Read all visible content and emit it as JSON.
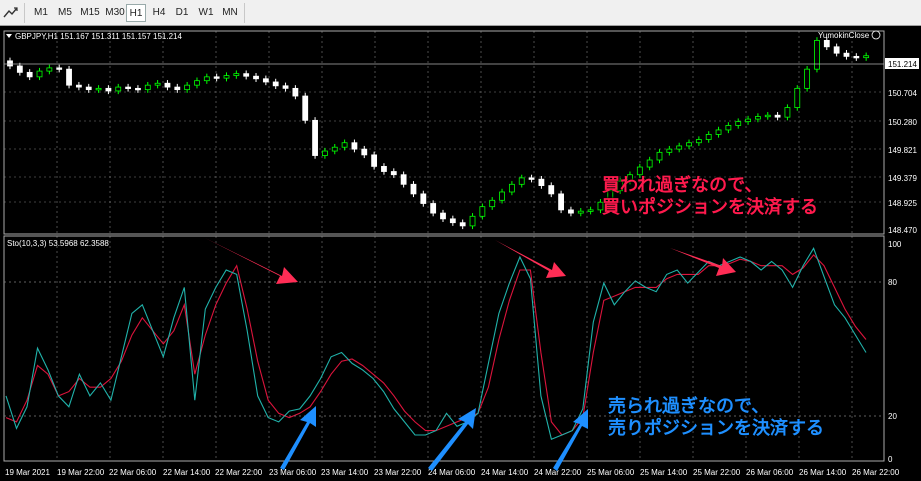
{
  "toolbar": {
    "timeframes": [
      "M1",
      "M5",
      "M15",
      "M30",
      "H1",
      "H4",
      "D1",
      "W1",
      "MN"
    ],
    "active": "H1"
  },
  "main_chart": {
    "header": "GBPJPY,H1  151.167 151.311 151.157 151.214",
    "indicator_label": "YumokinClose",
    "current_price": "151.214",
    "price_labels": [
      "150.704",
      "150.280",
      "149.821",
      "149.379",
      "148.925",
      "148.470"
    ]
  },
  "indicator": {
    "header": "Sto(10,3,3) 53.5968 62.3588",
    "levels": [
      "100",
      "80",
      "20",
      "0"
    ]
  },
  "time_axis": [
    "19 Mar 2021",
    "19 Mar 22:00",
    "22 Mar 06:00",
    "22 Mar 14:00",
    "22 Mar 22:00",
    "23 Mar 06:00",
    "23 Mar 14:00",
    "23 Mar 22:00",
    "24 Mar 06:00",
    "24 Mar 14:00",
    "24 Mar 22:00",
    "25 Mar 06:00",
    "25 Mar 14:00",
    "25 Mar 22:00",
    "26 Mar 06:00",
    "26 Mar 14:00",
    "26 Mar 22:00"
  ],
  "annotations": {
    "overbought": [
      "買われ過ぎなので、",
      "買いポジションを決済する"
    ],
    "oversold": [
      "売られ過ぎなので、",
      "売りポジションを決済する"
    ]
  },
  "colors": {
    "bull_candle": "#00ff00",
    "bear_candle": "#ffffff",
    "stoch_main": "#20b2aa",
    "stoch_signal": "#dc143c",
    "arrow_red": "#ff2d55",
    "arrow_blue": "#1e8fff",
    "grid": "#808080"
  },
  "chart_data": {
    "type": "candlestick",
    "closes": [
      151.05,
      150.95,
      150.88,
      150.97,
      151.02,
      151.0,
      150.75,
      150.72,
      150.68,
      150.7,
      150.66,
      150.72,
      150.7,
      150.68,
      150.75,
      150.78,
      150.72,
      150.68,
      150.75,
      150.82,
      150.88,
      150.86,
      150.9,
      150.93,
      150.89,
      150.85,
      150.8,
      150.74,
      150.7,
      150.58,
      150.2,
      149.65,
      149.72,
      149.78,
      149.85,
      149.75,
      149.66,
      149.48,
      149.4,
      149.35,
      149.2,
      149.05,
      148.9,
      148.75,
      148.66,
      148.6,
      148.55,
      148.7,
      148.85,
      148.95,
      149.08,
      149.2,
      149.3,
      149.28,
      149.18,
      149.05,
      148.8,
      148.75,
      148.78,
      148.8,
      148.92,
      149.1,
      149.25,
      149.35,
      149.47,
      149.58,
      149.7,
      149.75,
      149.8,
      149.85,
      149.9,
      149.98,
      150.05,
      150.12,
      150.18,
      150.22,
      150.26,
      150.28,
      150.25,
      150.4,
      150.7,
      151.0,
      151.45,
      151.35,
      151.25,
      151.2,
      151.18,
      151.21
    ],
    "stochastic_main": [
      30,
      15,
      25,
      52,
      42,
      30,
      25,
      40,
      30,
      36,
      28,
      48,
      68,
      72,
      60,
      48,
      66,
      80,
      28,
      70,
      80,
      88,
      86,
      60,
      30,
      20,
      18,
      23,
      24,
      30,
      38,
      48,
      50,
      45,
      42,
      38,
      32,
      24,
      18,
      12,
      12,
      14,
      22,
      16,
      18,
      22,
      45,
      68,
      82,
      94,
      84,
      30,
      10,
      12,
      14,
      24,
      64,
      82,
      72,
      78,
      83,
      80,
      78,
      86,
      88,
      82,
      87,
      92,
      90,
      92,
      94,
      92,
      88,
      92,
      88,
      80,
      90,
      98,
      85,
      72,
      66,
      58,
      50
    ],
    "stochastic_signal": [
      20,
      18,
      28,
      44,
      40,
      30,
      32,
      38,
      34,
      34,
      38,
      46,
      58,
      66,
      60,
      54,
      60,
      72,
      40,
      58,
      72,
      82,
      90,
      70,
      46,
      28,
      22,
      20,
      22,
      25,
      32,
      40,
      46,
      47,
      44,
      40,
      36,
      30,
      23,
      18,
      14,
      14,
      16,
      18,
      20,
      22,
      34,
      56,
      74,
      88,
      88,
      50,
      18,
      12,
      14,
      20,
      50,
      74,
      76,
      78,
      80,
      80,
      80,
      84,
      86,
      86,
      86,
      90,
      90,
      91,
      93,
      92,
      90,
      90,
      90,
      86,
      89,
      95,
      90,
      80,
      70,
      62,
      56
    ]
  }
}
